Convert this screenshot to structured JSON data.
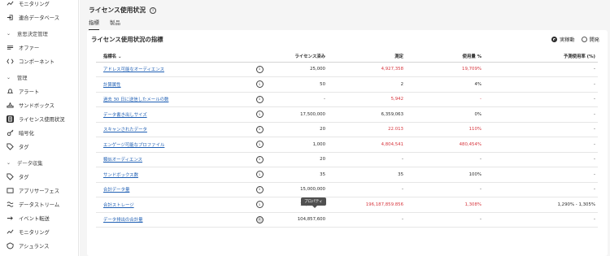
{
  "sidebar": {
    "items_top": [
      {
        "label": "モニタリング",
        "icon": "monitoring-icon"
      },
      {
        "label": "連合データベース",
        "icon": "federated-database-icon"
      }
    ],
    "sections": [
      {
        "title": "意思決定管理",
        "items": [
          {
            "label": "オファー",
            "icon": "offer-icon"
          },
          {
            "label": "コンポーネント",
            "icon": "components-icon"
          }
        ]
      },
      {
        "title": "管理",
        "items": [
          {
            "label": "アラート",
            "icon": "alert-icon"
          },
          {
            "label": "サンドボックス",
            "icon": "sandbox-icon"
          },
          {
            "label": "ライセンス使用状況",
            "icon": "license-usage-icon",
            "active": true
          },
          {
            "label": "暗号化",
            "icon": "encryption-icon"
          },
          {
            "label": "タグ",
            "icon": "tag-icon"
          }
        ]
      },
      {
        "title": "データ収集",
        "items": [
          {
            "label": "タグ",
            "icon": "tag-icon"
          },
          {
            "label": "アプリサーフェス",
            "icon": "app-surface-icon"
          },
          {
            "label": "データストリーム",
            "icon": "datastream-icon"
          },
          {
            "label": "イベント転送",
            "icon": "event-forwarding-icon"
          },
          {
            "label": "モニタリング",
            "icon": "monitoring-icon"
          },
          {
            "label": "アシュランス",
            "icon": "assurance-icon"
          }
        ]
      }
    ]
  },
  "header": {
    "title": "ライセンス使用状況",
    "tabs": [
      "指標",
      "製品"
    ]
  },
  "card": {
    "title": "ライセンス使用状況の指標",
    "environment_options": [
      "実稼動",
      "開発"
    ],
    "selected_environment": "実稼動"
  },
  "table": {
    "columns": {
      "name": "指標名 ⌄",
      "licensed": "ライセンス済み",
      "measured": "測定",
      "usage": "使用量 %",
      "predicted": "予測使用率 (%)"
    },
    "rows": [
      {
        "name": "アドレス可能なオーディエンス",
        "licensed": "25,000",
        "measured": "4,927,358",
        "usage": "19,709%",
        "predicted": "-",
        "over": true
      },
      {
        "name": "計算属性",
        "licensed": "50",
        "measured": "2",
        "usage": "4%",
        "predicted": "-",
        "over": false
      },
      {
        "name": "過去 30 日に送信したメールの数",
        "licensed": "-",
        "measured": "5,942",
        "usage": "-",
        "predicted": "-",
        "over": true
      },
      {
        "name": "データ書き出しサイズ",
        "licensed": "17,500,000",
        "measured": "6,359,063",
        "usage": "0%",
        "predicted": "-",
        "over": false
      },
      {
        "name": "スキャンされたデータ",
        "licensed": "20",
        "measured": "22.013",
        "usage": "110%",
        "predicted": "-",
        "over": true
      },
      {
        "name": "エンゲージ可能なプロファイル",
        "licensed": "1,000",
        "measured": "4,804,541",
        "usage": "480,454%",
        "predicted": "-",
        "over": true
      },
      {
        "name": "類似オーディエンス",
        "licensed": "20",
        "measured": "-",
        "usage": "-",
        "predicted": "-",
        "over": false
      },
      {
        "name": "サンドボックス数",
        "licensed": "35",
        "measured": "35",
        "usage": "100%",
        "predicted": "-",
        "over": false
      },
      {
        "name": "合計データ量",
        "licensed": "15,000,000",
        "measured": "-",
        "usage": "-",
        "predicted": "-",
        "over": false
      },
      {
        "name": "合計ストレージ",
        "licensed": "15,000,000",
        "measured": "196,187,859.856",
        "usage": "1,308%",
        "predicted": "1,290% - 1,305%",
        "over": true
      },
      {
        "name": "データ排出の合計量",
        "licensed": "104,857,600",
        "measured": "-",
        "usage": "-",
        "predicted": "-",
        "over": false
      }
    ]
  },
  "tooltip": "プロパティ",
  "colors": {
    "link": "#1f5fb4",
    "over_limit": "#d7373f",
    "background": "#f5f5f5"
  }
}
